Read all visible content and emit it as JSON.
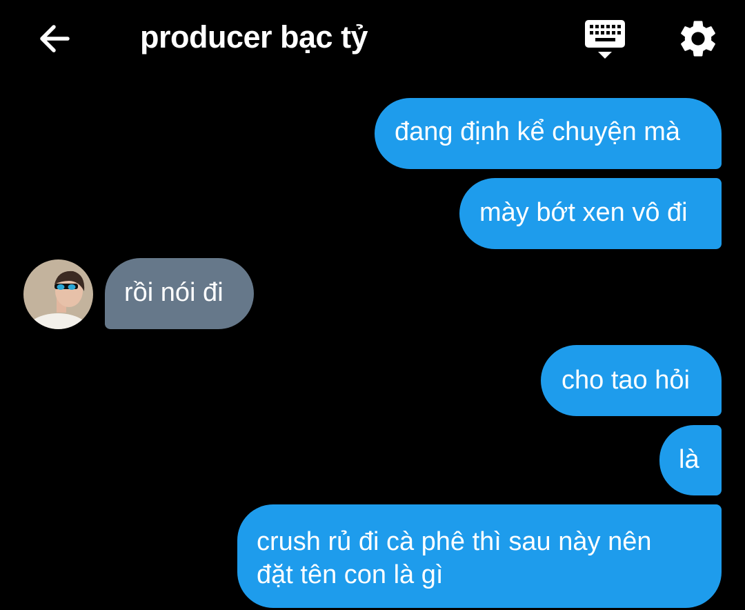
{
  "header": {
    "title": "producer bạc tỷ",
    "back_icon": "arrow-left-icon",
    "keyboard_icon": "keyboard-icon",
    "settings_icon": "gear-icon"
  },
  "colors": {
    "background": "#000000",
    "sent_bubble": "#1e9cec",
    "received_bubble": "#66788a",
    "text": "#ffffff"
  },
  "messages": [
    {
      "sender": "me",
      "text": "đang định kể chuyện mà"
    },
    {
      "sender": "me",
      "text": "mày bớt xen vô đi"
    },
    {
      "sender": "them",
      "text": "rồi nói đi"
    },
    {
      "sender": "me",
      "text": "cho tao hỏi"
    },
    {
      "sender": "me",
      "text": "là"
    },
    {
      "sender": "me",
      "text": "crush rủ đi cà phê thì sau này nên",
      "text_line2": "đặt tên con là gì"
    }
  ]
}
